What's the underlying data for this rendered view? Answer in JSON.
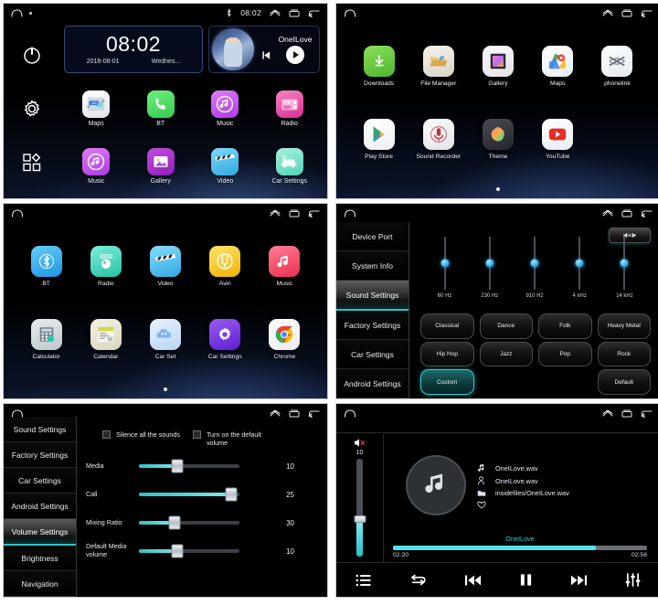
{
  "statusbar": {
    "home_icon": "home-icon",
    "dot_icon": "dot-icon",
    "bluetooth_icon": "bluetooth-icon",
    "clock": "08:02",
    "up_icon": "chevron-up-icon",
    "recents_icon": "recents-icon",
    "back_icon": "back-icon"
  },
  "panel1": {
    "name": "home-screen",
    "rail": [
      {
        "name": "power-button",
        "icon": "power-icon"
      },
      {
        "name": "settings-button",
        "icon": "gear-icon"
      },
      {
        "name": "apps-button",
        "icon": "apps-grid-icon"
      }
    ],
    "clock_widget": {
      "time": "08:02",
      "date": "2018-08-01",
      "weekday": "Wednes..."
    },
    "music_widget": {
      "title": "OneILove",
      "prev_label": "prev-track",
      "play_label": "play",
      "next_label": "next-track"
    },
    "apps": [
      {
        "label": "Maps",
        "icon": "maps-icon",
        "color": "#f2f4f6"
      },
      {
        "label": "BT",
        "icon": "phone-icon",
        "color": "#4cd964"
      },
      {
        "label": "Music",
        "icon": "music-note-icon",
        "color": "#c451e8"
      },
      {
        "label": "Radio",
        "icon": "radio-icon",
        "color": "#e8479e"
      },
      {
        "label": "Music",
        "icon": "music-note-icon",
        "color": "#c451e8"
      },
      {
        "label": "Gallery",
        "icon": "gallery-icon",
        "color": "#a635cf"
      },
      {
        "label": "Video",
        "icon": "video-clap-icon",
        "color": "#4fc3f7"
      },
      {
        "label": "Car Settings",
        "icon": "car-icon",
        "color": "#6fe3c4"
      }
    ]
  },
  "panel2": {
    "name": "app-drawer-page-1",
    "apps_row1": [
      {
        "label": "Downloads",
        "icon": "download-icon",
        "color": "#5fcb3a"
      },
      {
        "label": "File Manager",
        "icon": "folder-icon",
        "color": "#d9c08a"
      },
      {
        "label": "Gallery",
        "icon": "gallery-icon",
        "color": "#d36ad8"
      },
      {
        "label": "Maps",
        "icon": "maps-pin-icon",
        "color": "#f5f7f9"
      },
      {
        "label": "phonelink",
        "icon": "phonelink-icon",
        "color": "#f3f4f6"
      }
    ],
    "apps_row2": [
      {
        "label": "Play Store",
        "icon": "play-store-icon",
        "color": "#fafbfc"
      },
      {
        "label": "Sound Recorder",
        "icon": "microphone-icon",
        "color": "#f0f1f3"
      },
      {
        "label": "Theme",
        "icon": "theme-palette-icon",
        "color": "#3d3d48"
      },
      {
        "label": "YouTube",
        "icon": "youtube-icon",
        "color": "#fafbfc"
      }
    ],
    "page_indicator": "page-dot"
  },
  "panel3": {
    "name": "app-drawer-page-2",
    "apps_row1": [
      {
        "label": "BT",
        "icon": "bluetooth-icon",
        "color": "#3fb6f2"
      },
      {
        "label": "Radio",
        "icon": "radio-dial-icon",
        "color": "#44d7c0"
      },
      {
        "label": "Video",
        "icon": "video-clap-icon",
        "color": "#4fc3f7"
      },
      {
        "label": "Avin",
        "icon": "avin-icon",
        "color": "#ffd02e"
      },
      {
        "label": "Music",
        "icon": "music-note-icon",
        "color": "#f2506a"
      }
    ],
    "apps_row2": [
      {
        "label": "Calculator",
        "icon": "calculator-icon",
        "color": "#d5d9de"
      },
      {
        "label": "Calendar",
        "icon": "calendar-icon",
        "color": "#e9e6d2"
      },
      {
        "label": "Car Set",
        "icon": "cloud-car-icon",
        "color": "#cfe4f7"
      },
      {
        "label": "Car Settings",
        "icon": "gear-purple-icon",
        "color": "#7b3fe4"
      },
      {
        "label": "Chrome",
        "icon": "chrome-icon",
        "color": "#fafbfc"
      }
    ],
    "page_indicator": "page-dot"
  },
  "panel4": {
    "name": "sound-settings-screen",
    "sidebar": [
      {
        "label": "Device Port",
        "active": false
      },
      {
        "label": "System Info",
        "active": false
      },
      {
        "label": "Sound Settings",
        "active": true
      },
      {
        "label": "Factory Settings",
        "active": false
      },
      {
        "label": "Car Settings",
        "active": false
      },
      {
        "label": "Android Settings",
        "active": false
      }
    ],
    "speaker_button": "speaker-balance-icon",
    "equalizer": {
      "bands": [
        {
          "label": "60 Hz",
          "position_pct": 50
        },
        {
          "label": "230 Hz",
          "position_pct": 50
        },
        {
          "label": "910 Hz",
          "position_pct": 50
        },
        {
          "label": "4 kHz",
          "position_pct": 50
        },
        {
          "label": "14 kHz",
          "position_pct": 50
        }
      ]
    },
    "presets": [
      {
        "label": "Classical",
        "active": false
      },
      {
        "label": "Dance",
        "active": false
      },
      {
        "label": "Folk",
        "active": false
      },
      {
        "label": "Heavy Metal",
        "active": false
      },
      {
        "label": "Hip Hop",
        "active": false
      },
      {
        "label": "Jazz",
        "active": false
      },
      {
        "label": "Pop",
        "active": false
      },
      {
        "label": "Rock",
        "active": false
      },
      {
        "label": "Custom",
        "active": true
      },
      {
        "label": "",
        "active": false
      },
      {
        "label": "",
        "active": false
      },
      {
        "label": "Default",
        "active": false
      }
    ]
  },
  "panel5": {
    "name": "volume-settings-screen",
    "sidebar": [
      {
        "label": "Sound Settings",
        "active": false
      },
      {
        "label": "Factory Settings",
        "active": false
      },
      {
        "label": "Car Settings",
        "active": false
      },
      {
        "label": "Android Settings",
        "active": false
      },
      {
        "label": "Volume Settings",
        "active": true
      },
      {
        "label": "Brightness",
        "active": false
      },
      {
        "label": "Navigation",
        "active": false
      }
    ],
    "checkboxes": [
      {
        "label": "Silence all the sounds",
        "checked": false
      },
      {
        "label": "Turn on the default volume",
        "checked": false
      }
    ],
    "sliders": [
      {
        "label": "Media",
        "value": "10",
        "fill_pct": 38
      },
      {
        "label": "Call",
        "value": "25",
        "fill_pct": 92
      },
      {
        "label": "Mixing Ratio",
        "value": "30",
        "fill_pct": 35
      },
      {
        "label": "Default Media volume",
        "value": "10",
        "fill_pct": 38
      }
    ]
  },
  "panel6": {
    "name": "music-player-screen",
    "volume": {
      "mute_icon": "mute-icon",
      "value": "10",
      "fill_pct": 38
    },
    "album_icon": "music-note-icon",
    "meta": [
      {
        "icon": "music-note-icon",
        "text": "OneILove.wav"
      },
      {
        "icon": "artist-icon",
        "text": "OneILove.wav"
      },
      {
        "icon": "folder-icon",
        "text": "insidefiles/OneILove.wav"
      },
      {
        "icon": "heart-icon",
        "text": ""
      }
    ],
    "song_title": "OneILove",
    "elapsed": "02:20",
    "duration": "02:56",
    "progress_pct": 80,
    "controls": [
      {
        "name": "playlist-button",
        "icon": "list-icon"
      },
      {
        "name": "repeat-button",
        "icon": "repeat-icon"
      },
      {
        "name": "previous-button",
        "icon": "prev-icon"
      },
      {
        "name": "pause-button",
        "icon": "pause-icon"
      },
      {
        "name": "next-button",
        "icon": "next-icon"
      },
      {
        "name": "equalizer-button",
        "icon": "equalizer-icon"
      }
    ]
  },
  "colors": {
    "accent": "#26c6c8",
    "slider": "#56e0ea",
    "song": "#39c9d4"
  }
}
